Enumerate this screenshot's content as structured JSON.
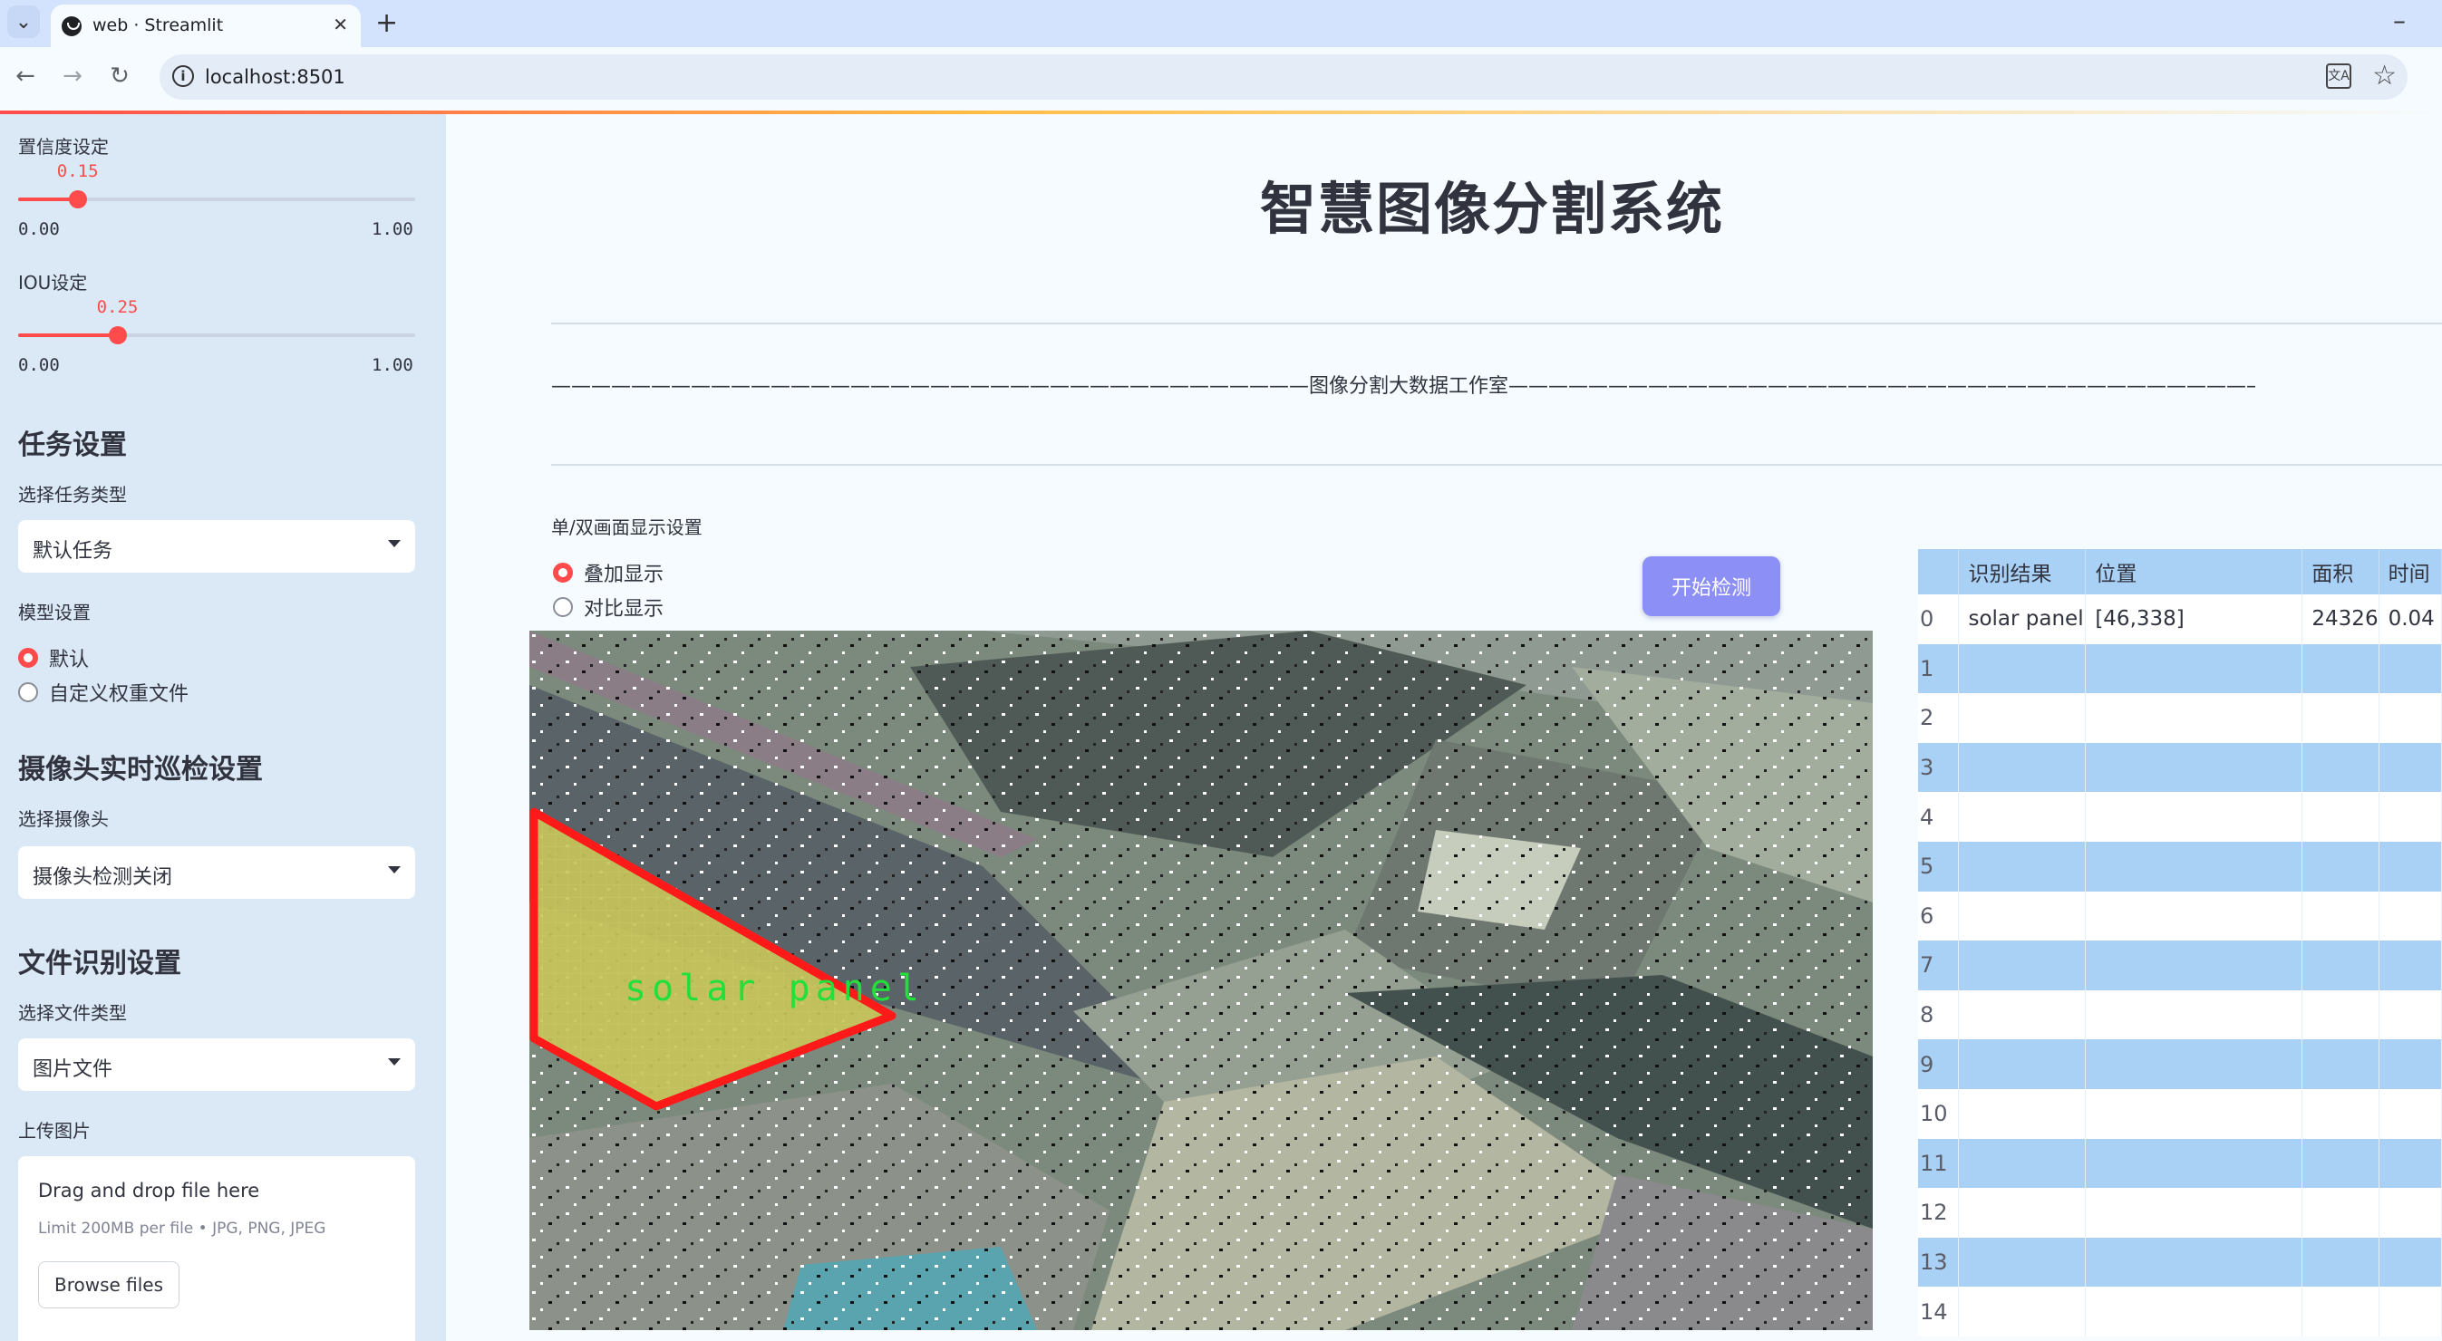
{
  "browser": {
    "tab_title": "web · Streamlit",
    "url": "localhost:8501"
  },
  "sidebar": {
    "confidence": {
      "label": "置信度设定",
      "value": "0.15",
      "fraction": 0.15,
      "min": "0.00",
      "max": "1.00"
    },
    "iou": {
      "label": "IOU设定",
      "value": "0.25",
      "fraction": 0.25,
      "min": "0.00",
      "max": "1.00"
    },
    "task_heading": "任务设置",
    "task_type_label": "选择任务类型",
    "task_type_value": "默认任务",
    "model_label": "模型设置",
    "model_options": [
      "默认",
      "自定义权重文件"
    ],
    "model_selected": "默认",
    "camera_heading": "摄像头实时巡检设置",
    "camera_label": "选择摄像头",
    "camera_value": "摄像头检测关闭",
    "file_heading": "文件识别设置",
    "file_type_label": "选择文件类型",
    "file_type_value": "图片文件",
    "upload_label": "上传图片",
    "uploader": {
      "drop_text": "Drag and drop file here",
      "limit_text": "Limit 200MB per file • JPG, PNG, JPEG",
      "browse_label": "Browse files"
    }
  },
  "main": {
    "title": "智慧图像分割系统",
    "divider_text": "——————————————————————————————————————图像分割大数据工作室——————————————————————————————————————————",
    "display_label": "单/双画面显示设置",
    "display_options": [
      "叠加显示",
      "对比显示"
    ],
    "display_selected": "叠加显示",
    "start_button": "开始检测",
    "detection_label": "solar panel"
  },
  "table": {
    "columns": [
      "",
      "识别结果",
      "位置",
      "面积",
      "时间"
    ],
    "rows": [
      [
        "0",
        "solar panel",
        "[46,338]",
        "24326",
        "0.04"
      ],
      [
        "1",
        "",
        "",
        "",
        ""
      ],
      [
        "2",
        "",
        "",
        "",
        ""
      ],
      [
        "3",
        "",
        "",
        "",
        ""
      ],
      [
        "4",
        "",
        "",
        "",
        ""
      ],
      [
        "5",
        "",
        "",
        "",
        ""
      ],
      [
        "6",
        "",
        "",
        "",
        ""
      ],
      [
        "7",
        "",
        "",
        "",
        ""
      ],
      [
        "8",
        "",
        "",
        "",
        ""
      ],
      [
        "9",
        "",
        "",
        "",
        ""
      ],
      [
        "10",
        "",
        "",
        "",
        ""
      ],
      [
        "11",
        "",
        "",
        "",
        ""
      ],
      [
        "12",
        "",
        "",
        "",
        ""
      ],
      [
        "13",
        "",
        "",
        "",
        ""
      ],
      [
        "14",
        "",
        "",
        "",
        ""
      ]
    ]
  },
  "colors": {
    "accent": "#ff4b4b",
    "button": "#8c8ff5",
    "table_stripe": "#a9d0f5",
    "sidebar_bg": "#dbe9f6",
    "mask_outline": "#ff1a1a",
    "label_text": "#22e03a"
  }
}
